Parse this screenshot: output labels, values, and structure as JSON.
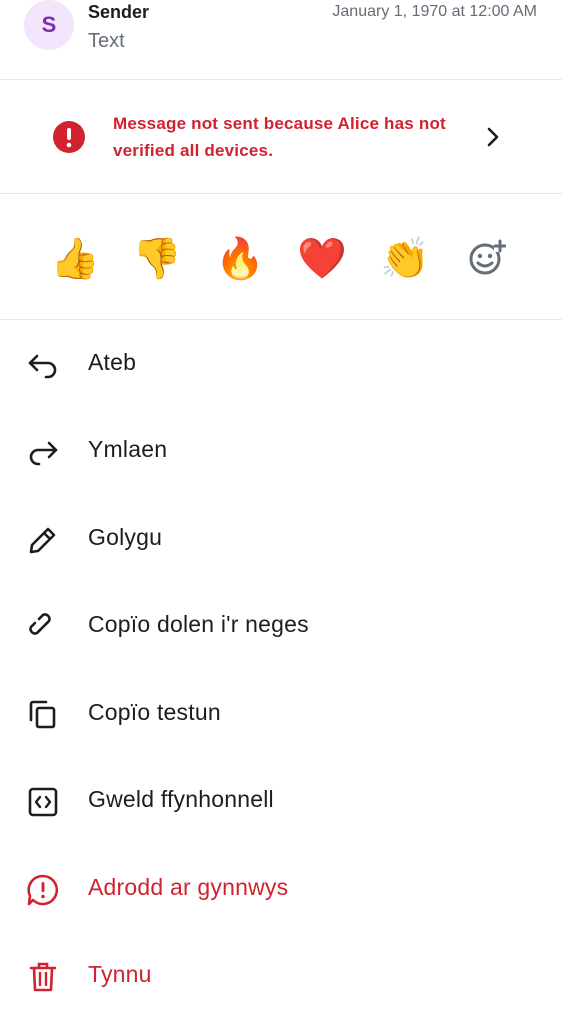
{
  "header": {
    "avatar_letter": "S",
    "sender": "Sender",
    "text": "Text",
    "timestamp": "January 1, 1970 at 12:00 AM"
  },
  "warning": {
    "message": "Message not sent because Alice has not verified all devices.",
    "icon": "error-icon",
    "color": "#d0222f"
  },
  "reactions": {
    "items": [
      "👍",
      "👎",
      "🔥",
      "❤️",
      "👏"
    ],
    "add_icon": "add-reaction-icon"
  },
  "menu": {
    "items": [
      {
        "label": "Ateb",
        "icon": "reply-icon"
      },
      {
        "label": "Ymlaen",
        "icon": "forward-icon"
      },
      {
        "label": "Golygu",
        "icon": "edit-icon"
      },
      {
        "label": "Copïo dolen i'r neges",
        "icon": "link-icon"
      },
      {
        "label": "Copïo testun",
        "icon": "copy-icon"
      },
      {
        "label": "Gweld ffynhonnell",
        "icon": "code-icon"
      },
      {
        "label": "Adrodd ar gynnwys",
        "icon": "report-icon"
      },
      {
        "label": "Tynnu",
        "icon": "delete-icon"
      }
    ]
  },
  "colors": {
    "danger": "#d0222f",
    "secondary_text": "#656d77",
    "avatar_bg": "#f3e5fb",
    "avatar_fg": "#7b2fb0"
  }
}
